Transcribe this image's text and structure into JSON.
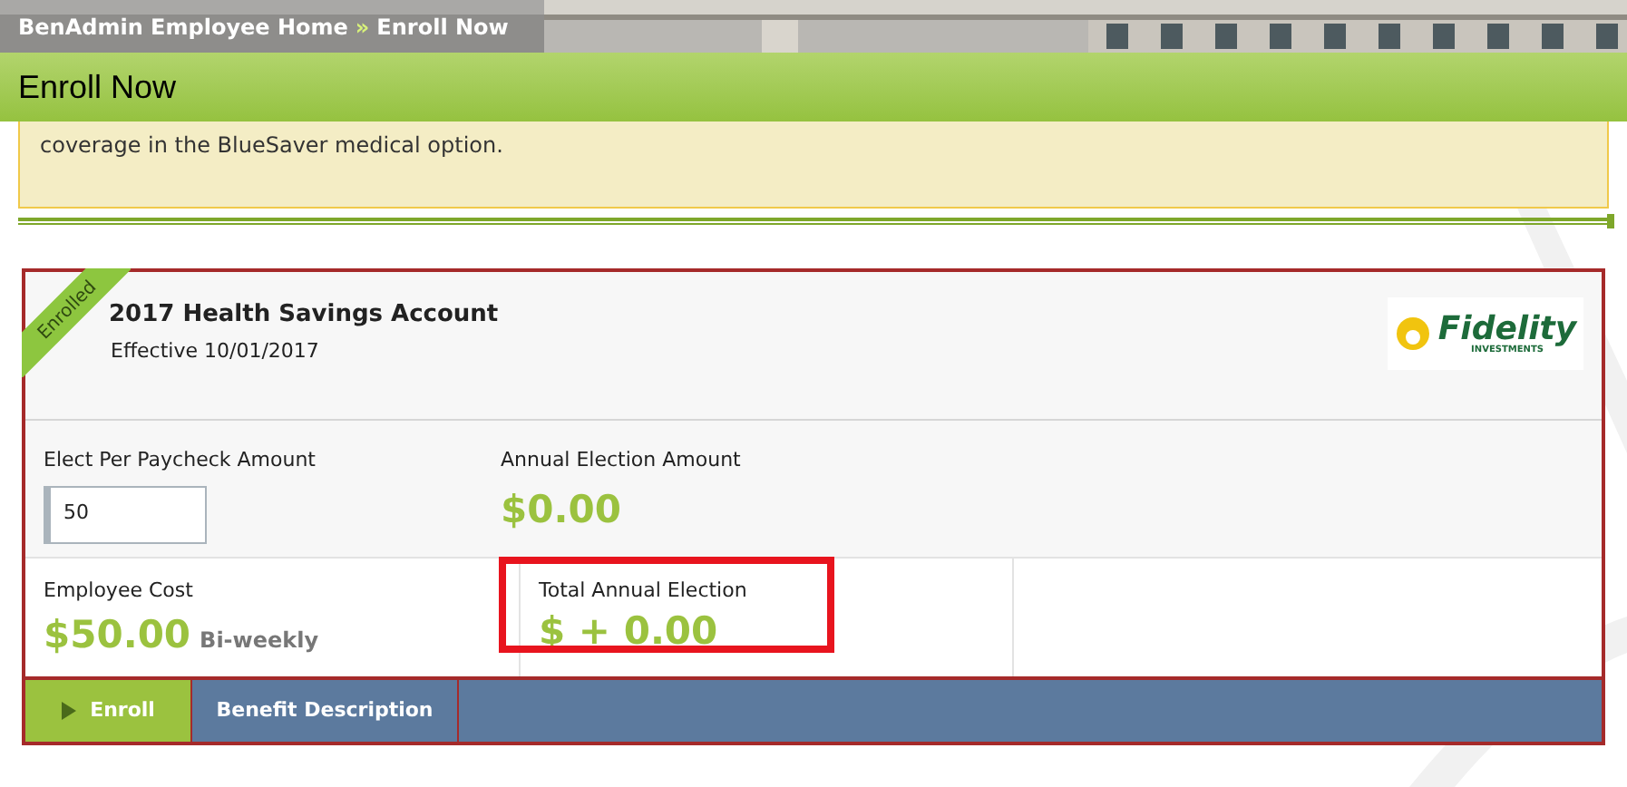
{
  "breadcrumb": [
    {
      "label": "BenAdmin Employee Home"
    },
    {
      "label": "Enroll Now"
    }
  ],
  "breadcrumb_separator": "»",
  "page_title": "Enroll Now",
  "notice": "coverage in the BlueSaver medical option.",
  "plan": {
    "ribbon": "Enrolled",
    "title": "2017 Health Savings Account",
    "effective": "Effective 10/01/2017",
    "logo": {
      "name": "Fidelity",
      "tagline": "INVESTMENTS"
    },
    "elect_label": "Elect Per Paycheck Amount",
    "elect_value": "50",
    "annual_label": "Annual Election Amount",
    "annual_value": "$0.00",
    "cost_label": "Employee Cost",
    "cost_value": "$50.00",
    "cost_period": "Bi-weekly",
    "total_label": "Total Annual Election",
    "total_value": "$ + 0.00",
    "total_highlighted": true
  },
  "actions": [
    {
      "label": "Enroll",
      "kind": "primary"
    },
    {
      "label": "Benefit Description",
      "kind": "secondary"
    }
  ]
}
